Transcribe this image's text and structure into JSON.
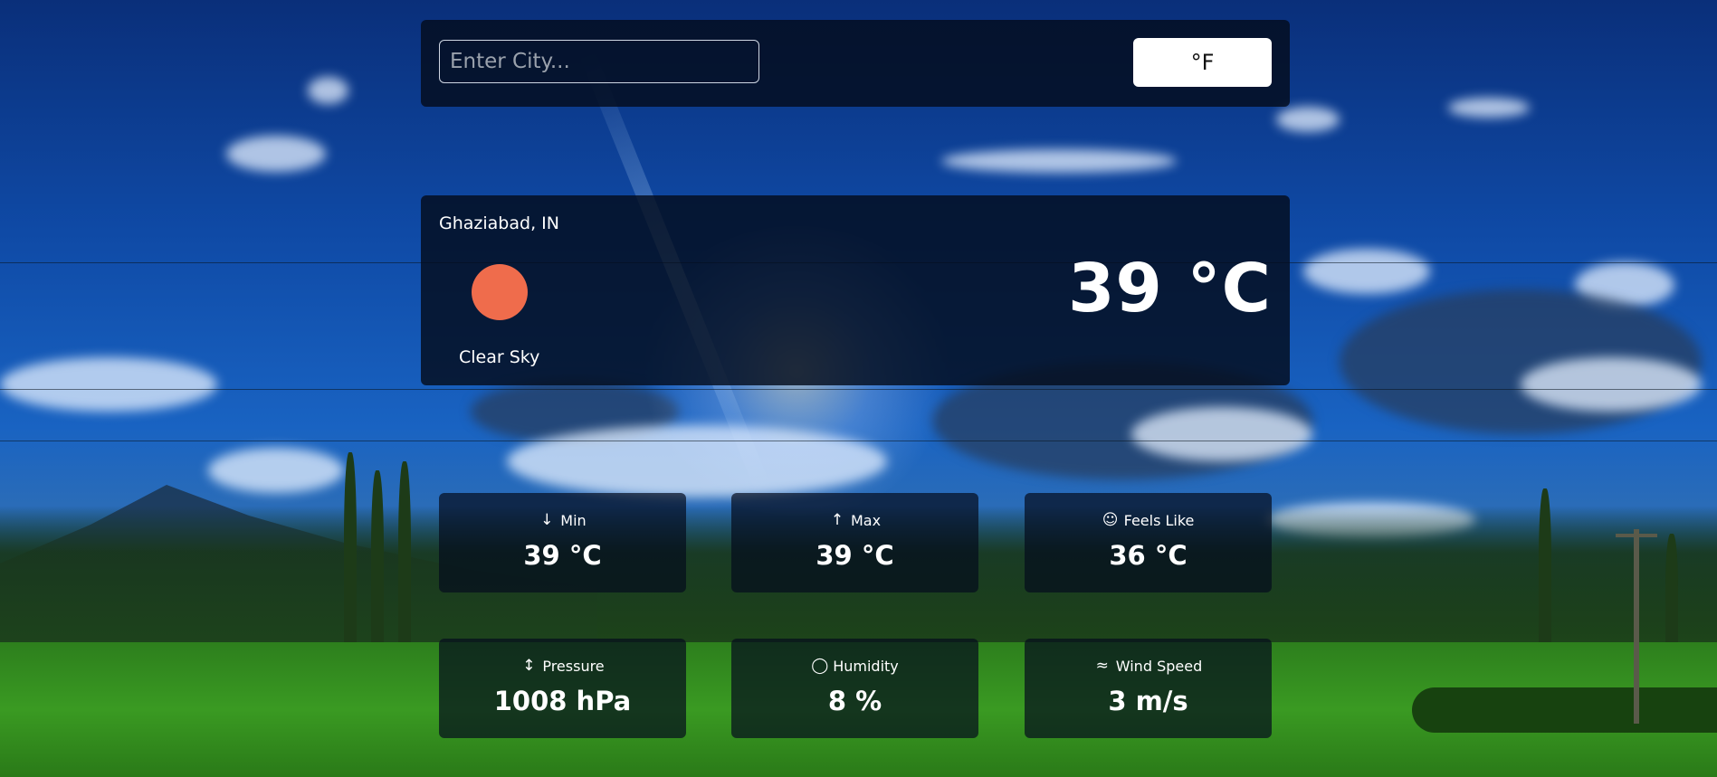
{
  "search": {
    "placeholder": "Enter City...",
    "value": ""
  },
  "unit_toggle": {
    "label": "°F"
  },
  "current": {
    "location": "Ghaziabad, IN",
    "icon": "clear-sky-sun-icon",
    "condition": "Clear Sky",
    "temperature": "39 °C"
  },
  "stats": [
    {
      "label": "Min",
      "value": "39 °C",
      "icon": "arrow-down-icon"
    },
    {
      "label": "Max",
      "value": "39 °C",
      "icon": "arrow-up-icon"
    },
    {
      "label": "Feels Like",
      "value": "36 °C",
      "icon": "smiley-icon"
    },
    {
      "label": "Pressure",
      "value": "1008 hPa",
      "icon": "pressure-icon"
    },
    {
      "label": "Humidity",
      "value": "8 %",
      "icon": "droplet-icon"
    },
    {
      "label": "Wind Speed",
      "value": "3 m/s",
      "icon": "wind-icon"
    }
  ],
  "colors": {
    "sun": "#ef6c4c",
    "card": "#040c1c",
    "button_bg": "#ffffff"
  }
}
